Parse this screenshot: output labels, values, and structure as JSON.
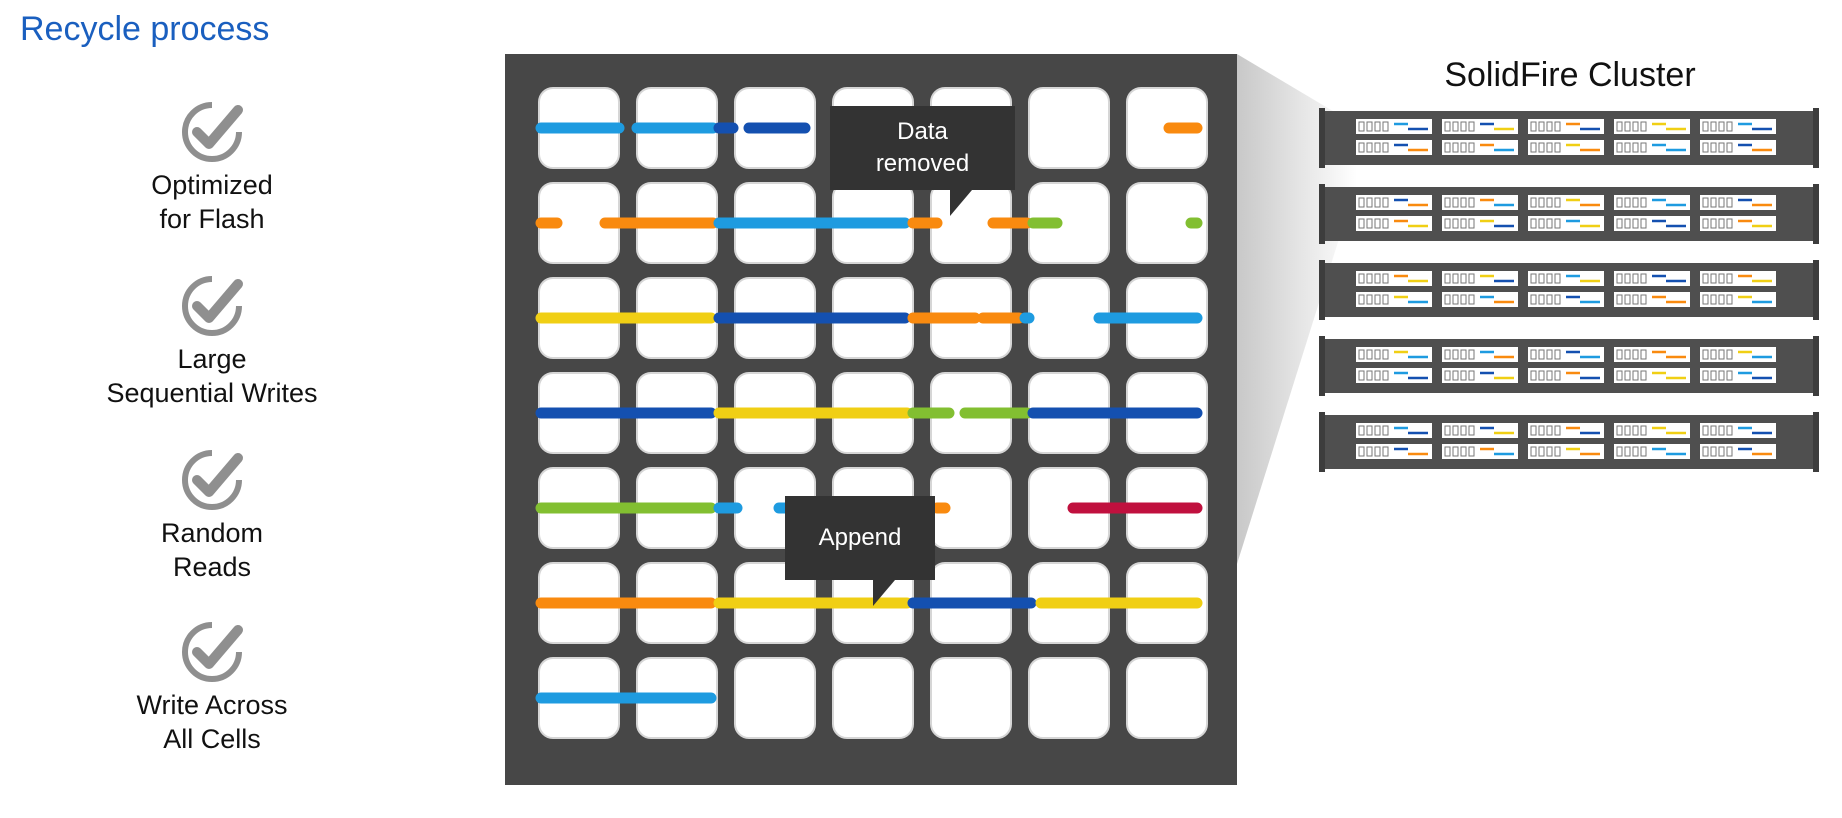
{
  "title": "Recycle process",
  "features": [
    {
      "label": "Optimized\nfor Flash",
      "icon": "check-circle-icon"
    },
    {
      "label": "Large\nSequential Writes",
      "icon": "check-circle-icon"
    },
    {
      "label": "Random\nReads",
      "icon": "check-circle-icon"
    },
    {
      "label": "Write Across\nAll Cells",
      "icon": "check-circle-icon"
    }
  ],
  "callouts": {
    "data_removed": "Data\nremoved",
    "append": "Append"
  },
  "cluster": {
    "title": "SolidFire Cluster",
    "node_count": 5
  },
  "colors": {
    "title": "#1a5fbf",
    "board": "#474747",
    "callout": "#333333",
    "check": "#8f8f8f",
    "light_blue": "#1e9be0",
    "dark_blue": "#1450b0",
    "orange": "#f98a0f",
    "green": "#82bf31",
    "yellow": "#f0cf14",
    "red": "#c0103e"
  },
  "grid": {
    "rows": 7,
    "cols": 7
  }
}
